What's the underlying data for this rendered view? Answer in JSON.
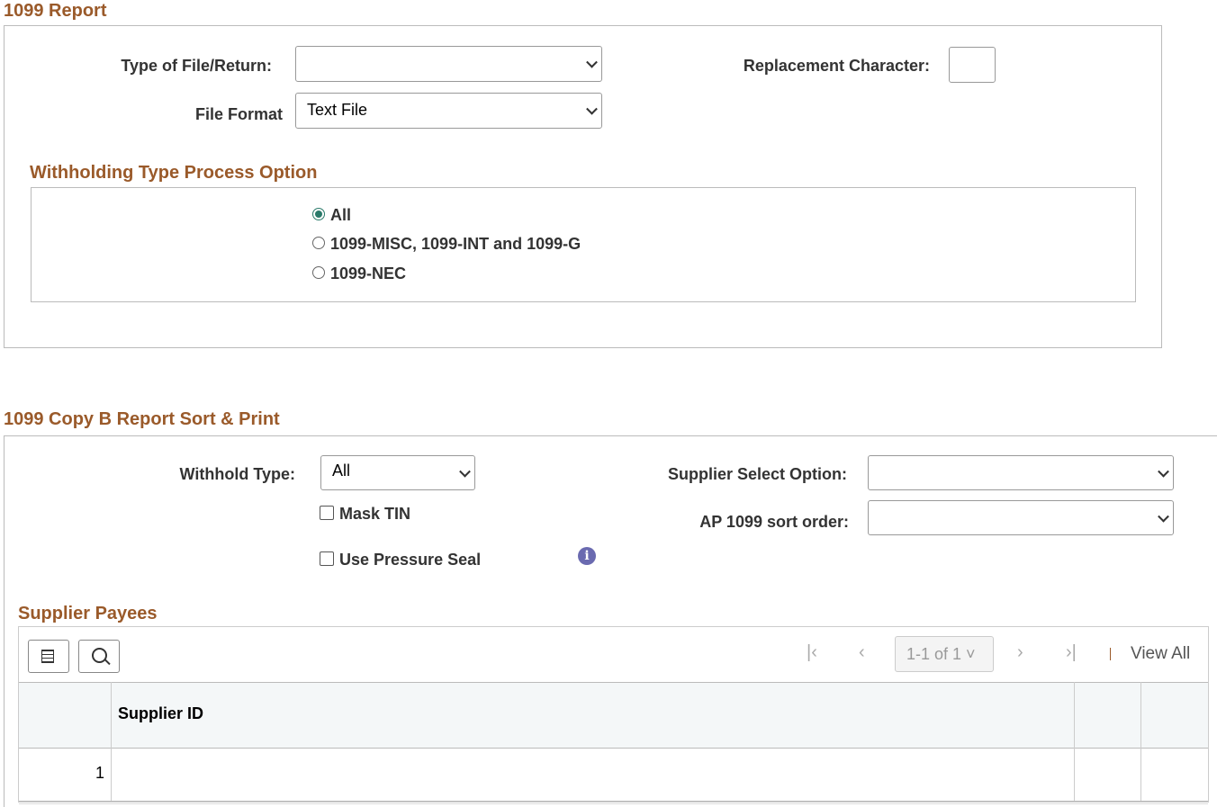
{
  "report": {
    "title": "1099 Report",
    "type_label": "Type of File/Return:",
    "type_value": "",
    "format_label": "File Format",
    "format_value": "Text File",
    "replacement_label": "Replacement Character:",
    "replacement_value": "",
    "withholding_title": "Withholding Type Process Option",
    "options": [
      {
        "label": "All",
        "selected": true
      },
      {
        "label": "1099-MISC, 1099-INT and 1099-G",
        "selected": false
      },
      {
        "label": "1099-NEC",
        "selected": false
      }
    ]
  },
  "copyb": {
    "title": "1099 Copy B Report Sort & Print",
    "withhold_label": "Withhold Type:",
    "withhold_value": "All",
    "mask_label": "Mask TIN",
    "pressure_label": "Use Pressure Seal",
    "supplier_select_label": "Supplier Select Option:",
    "supplier_select_value": "",
    "sort_label": "AP 1099 sort order:",
    "sort_value": ""
  },
  "payees": {
    "title": "Supplier Payees",
    "pager": "1-1 of 1",
    "view_all": "View All",
    "column": "Supplier ID",
    "rows": [
      {
        "num": "1",
        "supplier_id": ""
      }
    ]
  }
}
